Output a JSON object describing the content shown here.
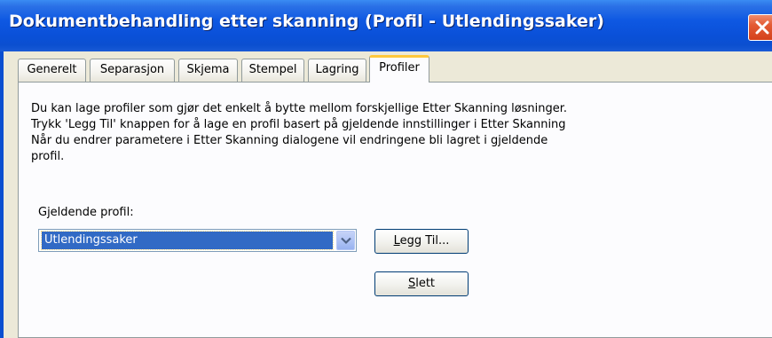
{
  "window": {
    "title": "Dokumentbehandling etter skanning (Profil - Utlendingssaker)"
  },
  "tabs": [
    {
      "label": "Generelt"
    },
    {
      "label": "Separasjon"
    },
    {
      "label": "Skjema"
    },
    {
      "label": "Stempel"
    },
    {
      "label": "Lagring"
    },
    {
      "label": "Profiler",
      "active": true
    }
  ],
  "description": [
    "Du kan lage profiler som gjør det enkelt å bytte mellom forskjellige Etter Skanning løsninger.",
    "Trykk 'Legg Til' knappen for å lage en profil basert på gjeldende innstillinger i Etter Skanning",
    "Når du endrer parametere i Etter Skanning dialogene vil endringene bli lagret i gjeldende",
    "profil."
  ],
  "profile": {
    "label": "Gjeldende profil:",
    "selected": "Utlendingssaker"
  },
  "buttons": {
    "add_prefix": "L",
    "add_rest": "egg Til...",
    "delete_prefix": "S",
    "delete_rest": "lett"
  },
  "colors": {
    "titlebar": "#0A50D8",
    "selection": "#316AC5",
    "active_tab_accent": "#FFC83C",
    "close_button": "#E35B34"
  }
}
